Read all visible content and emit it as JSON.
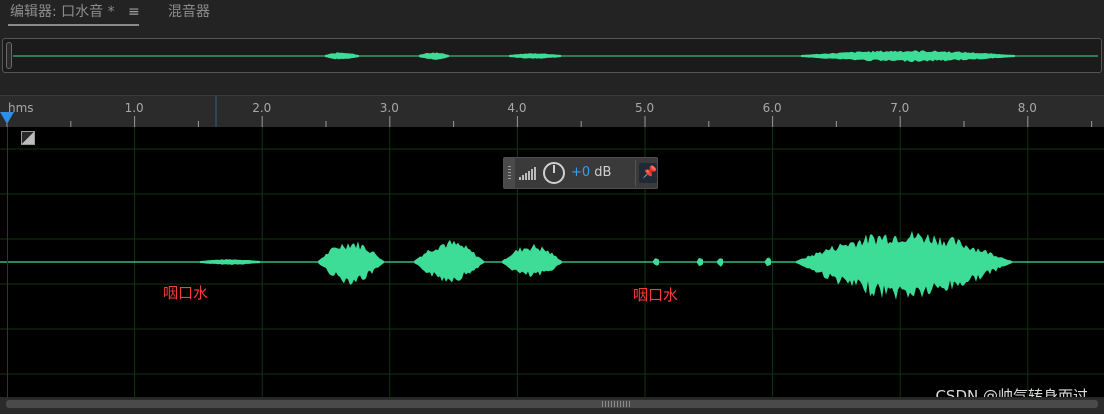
{
  "tabs": {
    "editor_label": "编辑器: 口水音 *",
    "menu_icon": "hamburger-menu-icon",
    "mixer_label": "混音器"
  },
  "ruler": {
    "unit_label": "hms",
    "ticks": [
      "1.0",
      "2.0",
      "3.0",
      "4.0",
      "5.0",
      "6.0",
      "7.0",
      "8.0"
    ]
  },
  "hud": {
    "volume_sign": "+0",
    "volume_unit": " dB",
    "pin_icon": "pin-icon",
    "knob_icon": "volume-knob-icon"
  },
  "annotations": {
    "first": "咽口水",
    "second": "咽口水"
  },
  "watermark": "CSDN @帅气转身而过",
  "colors": {
    "waveform": "#3ddc97",
    "grid": "#123312",
    "playhead": "#2f8fe6",
    "annotation": "#ff3b3b",
    "accent": "#3a9cf0"
  }
}
